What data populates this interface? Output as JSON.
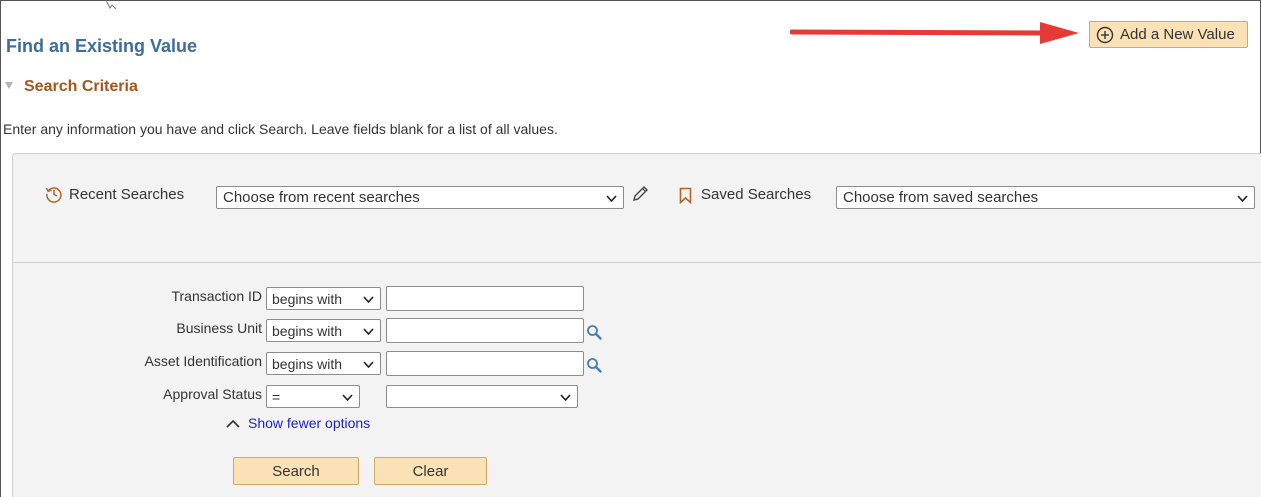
{
  "page_title": "Find an Existing Value",
  "add_button": {
    "label": "Add a New Value",
    "icon": "plus-circle-icon"
  },
  "section": {
    "title": "Search Criteria"
  },
  "instructions": "Enter any information you have and click Search. Leave fields blank for a list of all values.",
  "recent_searches": {
    "label": "Recent Searches",
    "selected": "Choose from recent searches"
  },
  "saved_searches": {
    "label": "Saved Searches",
    "selected": "Choose from saved searches"
  },
  "criteria": [
    {
      "label": "Transaction ID",
      "operator": "begins with",
      "value": "",
      "lookup": false
    },
    {
      "label": "Business Unit",
      "operator": "begins with",
      "value": "",
      "lookup": true
    },
    {
      "label": "Asset Identification",
      "operator": "begins with",
      "value": "",
      "lookup": true
    },
    {
      "label": "Approval Status",
      "operator": "=",
      "value": "",
      "lookup": false
    }
  ],
  "toggle_link": "Show fewer options",
  "buttons": {
    "search": "Search",
    "clear": "Clear"
  },
  "colors": {
    "title": "#3e6c9b",
    "section_title": "#a8551d",
    "button_bg": "#fbe1b6",
    "button_border": "#d2a863",
    "link": "#2222c8",
    "annotation_arrow": "#e53a35",
    "icon_accent": "#b5652b"
  }
}
